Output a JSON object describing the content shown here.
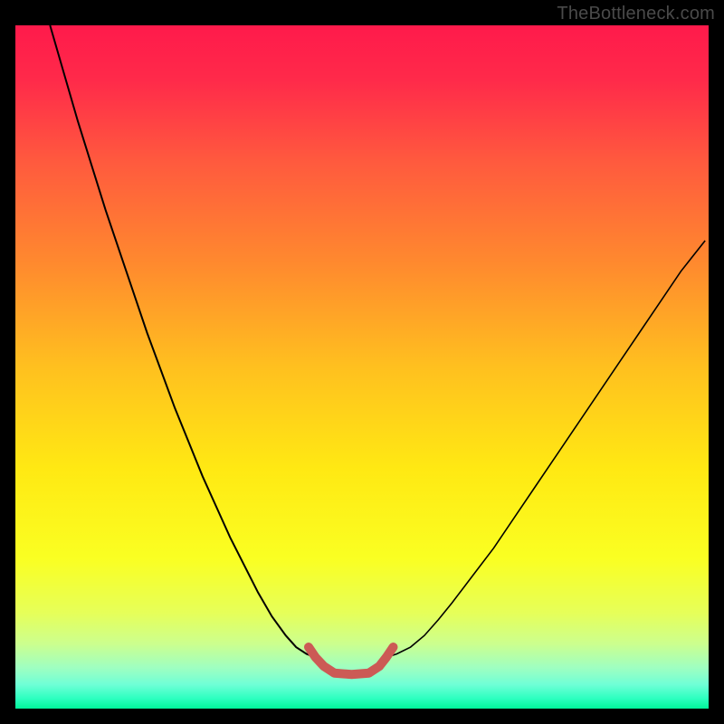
{
  "watermark": "TheBottleneck.com",
  "chart_data": {
    "type": "line",
    "title": "",
    "xlabel": "",
    "ylabel": "",
    "xlim": [
      0,
      100
    ],
    "ylim": [
      0,
      100
    ],
    "grid": false,
    "y_axis_inverted": true,
    "gradient_stops": [
      {
        "offset": 0.0,
        "color": "#ff1a4b"
      },
      {
        "offset": 0.08,
        "color": "#ff2a4a"
      },
      {
        "offset": 0.2,
        "color": "#ff5a3e"
      },
      {
        "offset": 0.35,
        "color": "#ff8a2e"
      },
      {
        "offset": 0.5,
        "color": "#ffc01f"
      },
      {
        "offset": 0.65,
        "color": "#ffe913"
      },
      {
        "offset": 0.78,
        "color": "#faff22"
      },
      {
        "offset": 0.86,
        "color": "#e6ff59"
      },
      {
        "offset": 0.905,
        "color": "#ccff8e"
      },
      {
        "offset": 0.94,
        "color": "#9fffc1"
      },
      {
        "offset": 0.965,
        "color": "#6fffd6"
      },
      {
        "offset": 0.985,
        "color": "#2dffc0"
      },
      {
        "offset": 1.0,
        "color": "#00f59a"
      }
    ],
    "series": [
      {
        "name": "left-curve",
        "stroke": "#000000",
        "stroke_width": 2.0,
        "x": [
          5.0,
          7,
          9,
          11,
          13,
          15,
          17,
          19,
          21,
          23,
          25,
          27,
          29,
          31,
          33,
          35,
          37,
          39,
          40.5,
          42,
          43.3
        ],
        "y": [
          0.0,
          7,
          14,
          20.5,
          27,
          33,
          39,
          45,
          50.5,
          56,
          61,
          66,
          70.5,
          75,
          79,
          83,
          86.5,
          89.3,
          91,
          92,
          92.5
        ]
      },
      {
        "name": "right-curve",
        "stroke": "#000000",
        "stroke_width": 1.6,
        "x": [
          53.5,
          55,
          57,
          59,
          61,
          63,
          66,
          69,
          72,
          75,
          78,
          81,
          84,
          87,
          90,
          93,
          96,
          99.5
        ],
        "y": [
          92.5,
          92,
          91,
          89.3,
          87,
          84.5,
          80.5,
          76.5,
          72,
          67.5,
          63,
          58.5,
          54,
          49.5,
          45,
          40.5,
          36,
          31.5
        ]
      },
      {
        "name": "bottom-segment",
        "stroke": "#cc5a55",
        "stroke_width": 10,
        "linecap": "round",
        "x": [
          42.3,
          43.3,
          44.5,
          46,
          48.5,
          51,
          52.5,
          53.5,
          54.5
        ],
        "y": [
          91.0,
          92.5,
          93.8,
          94.8,
          95.0,
          94.8,
          93.8,
          92.5,
          91.0
        ]
      }
    ]
  }
}
